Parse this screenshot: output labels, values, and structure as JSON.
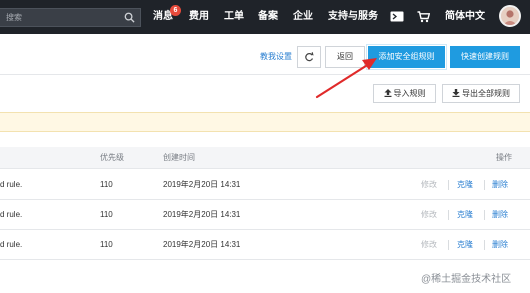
{
  "topbar": {
    "search_placeholder": "搜索",
    "nav": {
      "messages": "消息",
      "messages_badge": "6",
      "billing": "费用",
      "tickets": "工单",
      "filing": "备案",
      "enterprise": "企业",
      "support": "支持与服务",
      "language": "简体中文"
    }
  },
  "toolbar": {
    "settings_link": "教我设置",
    "back_button": "返回",
    "add_rule_button": "添加安全组规则",
    "quick_create_button": "快速创建规则",
    "import_button": "导入规则",
    "export_button": "导出全部规则"
  },
  "table": {
    "headers": {
      "priority": "优先级",
      "created": "创建时间",
      "actions": "操作"
    },
    "rows": [
      {
        "desc": "d rule.",
        "priority": "110",
        "created": "2019年2月20日 14:31",
        "modify": "修改",
        "clone": "克隆",
        "delete": "删除"
      },
      {
        "desc": "d rule.",
        "priority": "110",
        "created": "2019年2月20日 14:31",
        "modify": "修改",
        "clone": "克隆",
        "delete": "删除"
      },
      {
        "desc": "d rule.",
        "priority": "110",
        "created": "2019年2月20日 14:31",
        "modify": "修改",
        "clone": "克隆",
        "delete": "删除"
      }
    ]
  },
  "watermark": "@稀土掘金技术社区",
  "colors": {
    "topbar_bg": "#1f2329",
    "primary_blue": "#1f9be0",
    "link_blue": "#2a7fd1",
    "badge_red": "#e64a3b",
    "arrow_red": "#e02a2a",
    "notice_bg": "#fff8e4"
  }
}
